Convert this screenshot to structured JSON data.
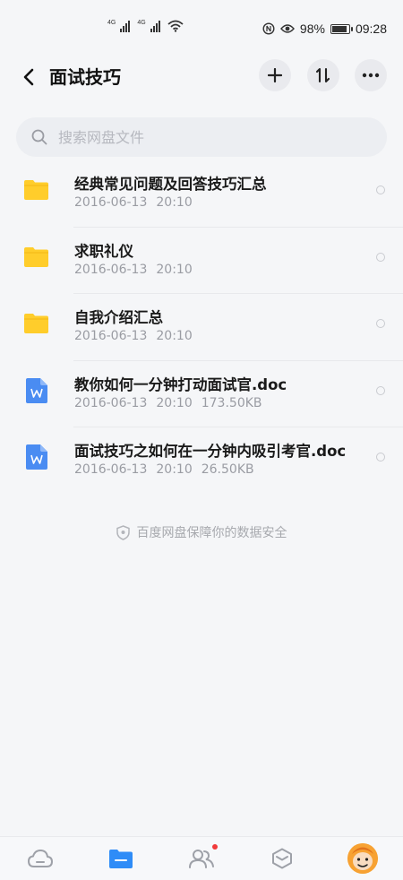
{
  "status_bar": {
    "net1": "4G",
    "net2": "4G",
    "battery": "98%",
    "battery_level": 0.98,
    "time": "09:28"
  },
  "header": {
    "title": "面试技巧",
    "back_icon": "chevron-left-icon",
    "add_icon": "plus-icon",
    "sort_icon": "sort-icon",
    "more_icon": "more-icon"
  },
  "search": {
    "placeholder": "搜索网盘文件",
    "value": ""
  },
  "files": [
    {
      "type": "folder",
      "name": "经典常见问题及回答技巧汇总",
      "date": "2016-06-13",
      "time": "20:10",
      "size": ""
    },
    {
      "type": "folder",
      "name": "求职礼仪",
      "date": "2016-06-13",
      "time": "20:10",
      "size": ""
    },
    {
      "type": "folder",
      "name": "自我介绍汇总",
      "date": "2016-06-13",
      "time": "20:10",
      "size": ""
    },
    {
      "type": "doc",
      "name": "教你如何一分钟打动面试官.doc",
      "date": "2016-06-13",
      "time": "20:10",
      "size": "173.50KB"
    },
    {
      "type": "doc",
      "name": "面试技巧之如何在一分钟内吸引考官.doc",
      "date": "2016-06-13",
      "time": "20:10",
      "size": "26.50KB"
    }
  ],
  "footer_note": "百度网盘保障你的数据安全",
  "bottom_nav": [
    {
      "name": "cloud-icon",
      "active": false
    },
    {
      "name": "folder-icon",
      "active": true
    },
    {
      "name": "people-icon",
      "active": false,
      "badge": true
    },
    {
      "name": "box-icon",
      "active": false
    },
    {
      "name": "avatar",
      "active": false
    }
  ],
  "colors": {
    "accent": "#2f8cf7",
    "folder": "#ffcd2b",
    "doc": "#4a8cf2",
    "badge": "#f13a3a"
  }
}
